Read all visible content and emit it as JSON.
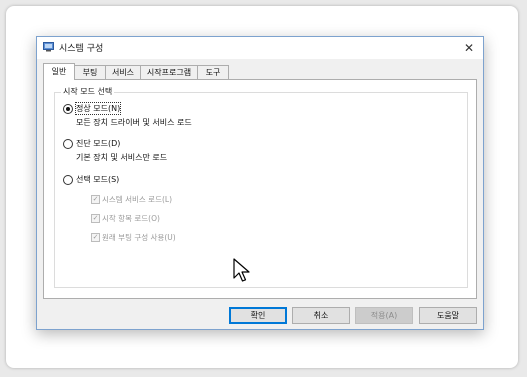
{
  "window": {
    "title": "시스템 구성",
    "close_glyph": "✕",
    "icon": "msconfig-icon"
  },
  "tabs": [
    {
      "label": "일반",
      "active": true
    },
    {
      "label": "부팅",
      "active": false
    },
    {
      "label": "서비스",
      "active": false
    },
    {
      "label": "시작프로그램",
      "active": false
    },
    {
      "label": "도구",
      "active": false
    }
  ],
  "group": {
    "title": "시작 모드 선택",
    "options": [
      {
        "label": "정상 모드(N)",
        "description": "모든 장치 드라이버 및 서비스 로드",
        "selected": true
      },
      {
        "label": "진단 모드(D)",
        "description": "기본 장치 및 서비스만 로드",
        "selected": false
      },
      {
        "label": "선택 모드(S)",
        "selected": false
      }
    ],
    "suboptions": [
      {
        "label": "시스템 서비스 로드(L)",
        "checked": true,
        "enabled": false
      },
      {
        "label": "시작 항목 로드(O)",
        "checked": true,
        "enabled": false
      },
      {
        "label": "원래 부팅 구성 사용(U)",
        "checked": true,
        "enabled": false
      }
    ]
  },
  "buttons": {
    "ok": "확인",
    "cancel": "취소",
    "apply": "적용(A)",
    "help": "도움말"
  },
  "colors": {
    "accent": "#0078d7",
    "window_border": "#7da2ce",
    "disabled_text": "#9a9a9a"
  }
}
